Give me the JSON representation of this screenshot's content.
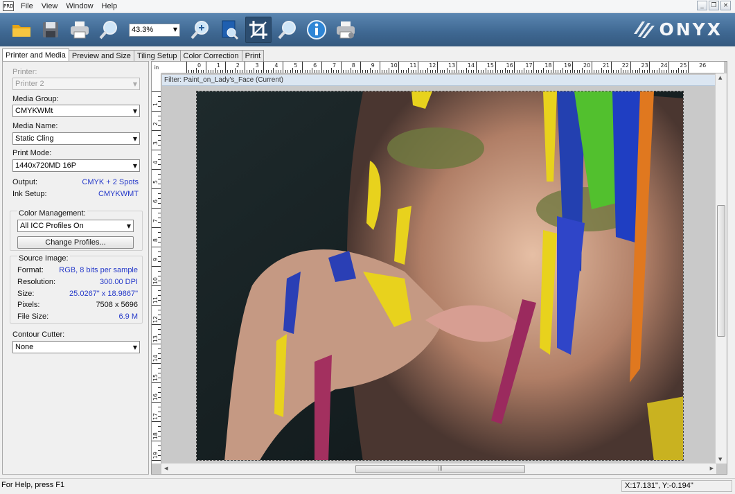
{
  "app_icon": "PRD",
  "menu": [
    "File",
    "View",
    "Window",
    "Help"
  ],
  "window_controls": [
    "_",
    "❐",
    "×"
  ],
  "toolbar": {
    "zoom_value": "43.3%",
    "buttons": [
      "open-folder-icon",
      "save-icon",
      "print-icon",
      "zoom-out-icon",
      "zoom-in-icon",
      "page-preview-icon",
      "crop-icon",
      "magnify-icon",
      "info-icon",
      "printer-settings-icon"
    ]
  },
  "logo_text": "ONYX",
  "tabs": [
    "Printer and Media",
    "Preview and Size",
    "Tiling Setup",
    "Color Correction",
    "Print"
  ],
  "panel": {
    "printer_label": "Printer:",
    "printer_value": "Printer 2",
    "media_group_label": "Media Group:",
    "media_group_value": "CMYKWMt",
    "media_name_label": "Media Name:",
    "media_name_value": "Static Cling",
    "print_mode_label": "Print Mode:",
    "print_mode_value": "1440x720MD 16P",
    "output_label": "Output:",
    "output_value": "CMYK + 2 Spots",
    "ink_setup_label": "Ink Setup:",
    "ink_setup_value": "CMYKWMT",
    "color_mgmt_label": "Color Management:",
    "color_mgmt_value": "All ICC Profiles On",
    "change_profiles_label": "Change Profiles...",
    "source_image_label": "Source Image:",
    "format_label": "Format:",
    "format_value": "RGB, 8 bits per sample",
    "resolution_label": "Resolution:",
    "resolution_value": "300.00 DPI",
    "size_label": "Size:",
    "size_value": "25.0267\" x 18.9867\"",
    "pixels_label": "Pixels:",
    "pixels_value": "7508 x 5696",
    "file_size_label": "File Size:",
    "file_size_value": "6.9 M",
    "contour_cutter_label": "Contour Cutter:",
    "contour_cutter_value": "None"
  },
  "canvas": {
    "ruler_unit": "in",
    "hruler_numbers": [
      "0",
      "1",
      "2",
      "3",
      "4",
      "5",
      "6",
      "7",
      "8",
      "9",
      "10",
      "11",
      "12",
      "13",
      "14",
      "15",
      "16",
      "17",
      "18",
      "19",
      "20",
      "21",
      "22",
      "23",
      "24",
      "25",
      "26"
    ],
    "vruler_numbers": [
      "1",
      "2",
      "3",
      "4",
      "5",
      "6",
      "7",
      "8",
      "9",
      "10",
      "11",
      "12",
      "13",
      "14",
      "15",
      "16",
      "17",
      "18",
      "19"
    ],
    "filter_text": "Filter: Paint_on_Lady's_Face (Current)",
    "scroll_grip": "|||"
  },
  "statusbar": {
    "help_text": "For Help, press F1",
    "coords_text": "X:17.131\", Y:-0.194\""
  }
}
